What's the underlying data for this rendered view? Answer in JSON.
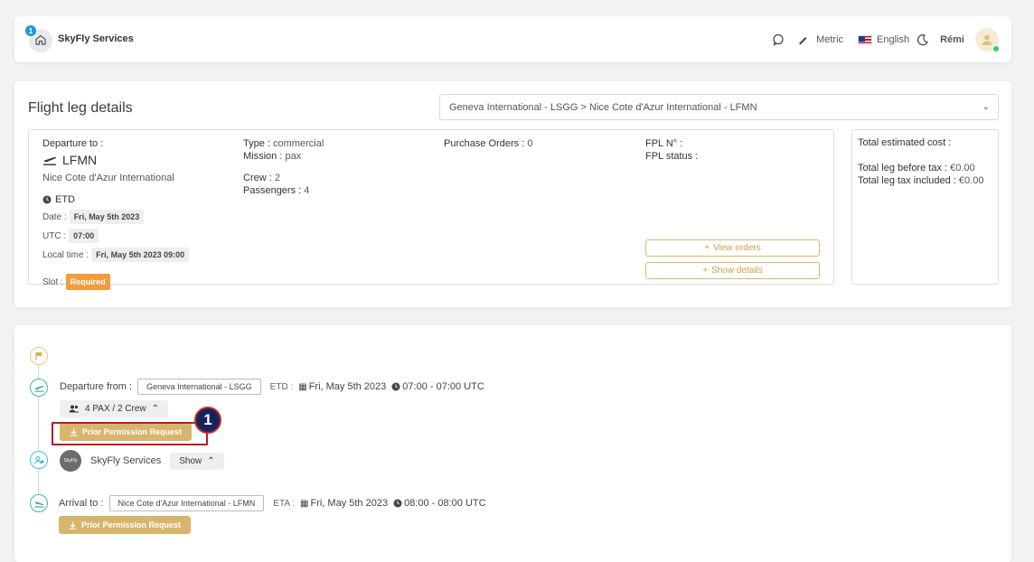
{
  "header": {
    "notification_count": "1",
    "brand": "SkyFly Services",
    "units": "Metric",
    "language": "English",
    "user_name": "Rémi"
  },
  "leg_details": {
    "title": "Flight leg details",
    "selected_leg": "Geneva International - LSGG > Nice Cote d'Azur International - LFMN",
    "departure": {
      "label": "Departure to :",
      "code": "LFMN",
      "airport": "Nice Cote d'Azur International",
      "etd_label": "ETD",
      "date_label": "Date :",
      "date": "Fri, May 5th 2023",
      "utc_label": "UTC :",
      "utc": "07:00",
      "local_label": "Local time :",
      "local": "Fri, May 5th 2023 09:00",
      "slot_label": "Slot :",
      "slot": "Required"
    },
    "type_label": "Type :",
    "type": "commercial",
    "mission_label": "Mission :",
    "mission": "pax",
    "crew_label": "Crew :",
    "crew": "2",
    "passengers_label": "Passengers :",
    "passengers": "4",
    "po_label": "Purchase Orders :",
    "po": "0",
    "fpl_no_label": "FPL N° :",
    "fpl_status_label": "FPL status :",
    "view_orders": "View orders",
    "show_details": "Show details",
    "cost": {
      "title": "Total estimated cost :",
      "before_tax_label": "Total leg before tax :",
      "before_tax": "€0.00",
      "included_label": "Total leg tax included :",
      "included": "€0.00"
    }
  },
  "timeline": {
    "departure_label": "Departure from :",
    "departure_airport": "Geneva International - LSGG",
    "etd_label": "ETD :",
    "etd_date": "Fri, May 5th 2023",
    "etd_time": "07:00 - 07:00 UTC",
    "pax_crew": "4 PAX / 2 Crew",
    "ppr_label": "Prior Permission Request",
    "operator_logo_text": "SkyFly",
    "operator": "SkyFly Services",
    "show_label": "Show",
    "arrival_label": "Arrival to :",
    "arrival_airport": "Nice Cote d'Azur International - LFMN",
    "eta_label": "ETA :",
    "eta_date": "Fri, May 5th 2023",
    "eta_time": "08:00 - 08:00 UTC",
    "step_number": "1"
  },
  "colors": {
    "gold": "#d7b56d",
    "orange": "#f39c3c",
    "highlight_red": "#b21f24",
    "badge_navy": "#16235a"
  }
}
